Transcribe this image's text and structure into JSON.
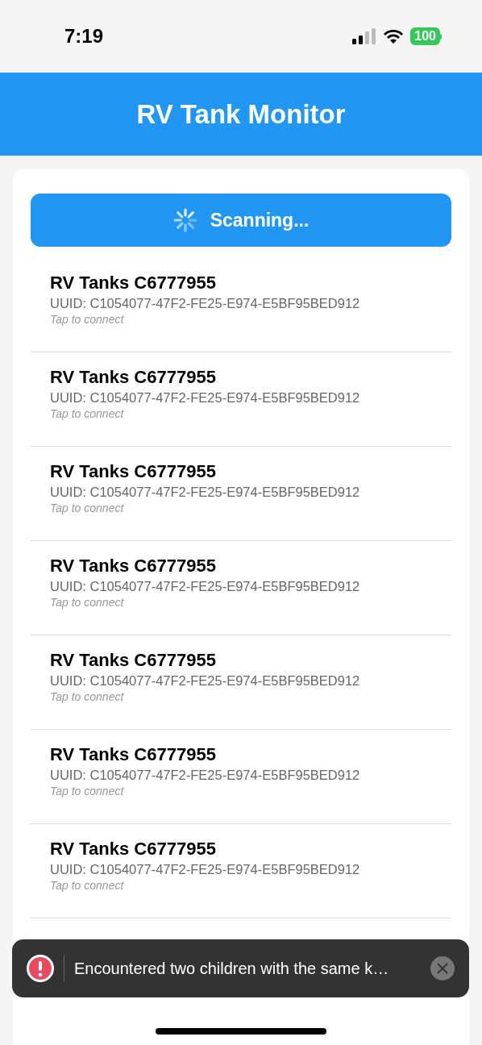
{
  "status_bar": {
    "time": "7:19",
    "battery": "100"
  },
  "header": {
    "title": "RV Tank Monitor"
  },
  "scan_button": {
    "label": "Scanning...",
    "scanning": true
  },
  "devices": [
    {
      "name": "RV Tanks C6777955",
      "uuid": "UUID: C1054077-47F2-FE25-E974-E5BF95BED912",
      "hint": "Tap to connect"
    },
    {
      "name": "RV Tanks C6777955",
      "uuid": "UUID: C1054077-47F2-FE25-E974-E5BF95BED912",
      "hint": "Tap to connect"
    },
    {
      "name": "RV Tanks C6777955",
      "uuid": "UUID: C1054077-47F2-FE25-E974-E5BF95BED912",
      "hint": "Tap to connect"
    },
    {
      "name": "RV Tanks C6777955",
      "uuid": "UUID: C1054077-47F2-FE25-E974-E5BF95BED912",
      "hint": "Tap to connect"
    },
    {
      "name": "RV Tanks C6777955",
      "uuid": "UUID: C1054077-47F2-FE25-E974-E5BF95BED912",
      "hint": "Tap to connect"
    },
    {
      "name": "RV Tanks C6777955",
      "uuid": "UUID: C1054077-47F2-FE25-E974-E5BF95BED912",
      "hint": "Tap to connect"
    },
    {
      "name": "RV Tanks C6777955",
      "uuid": "UUID: C1054077-47F2-FE25-E974-E5BF95BED912",
      "hint": "Tap to connect"
    }
  ],
  "toast": {
    "message": "Encountered two children with the same k…"
  }
}
